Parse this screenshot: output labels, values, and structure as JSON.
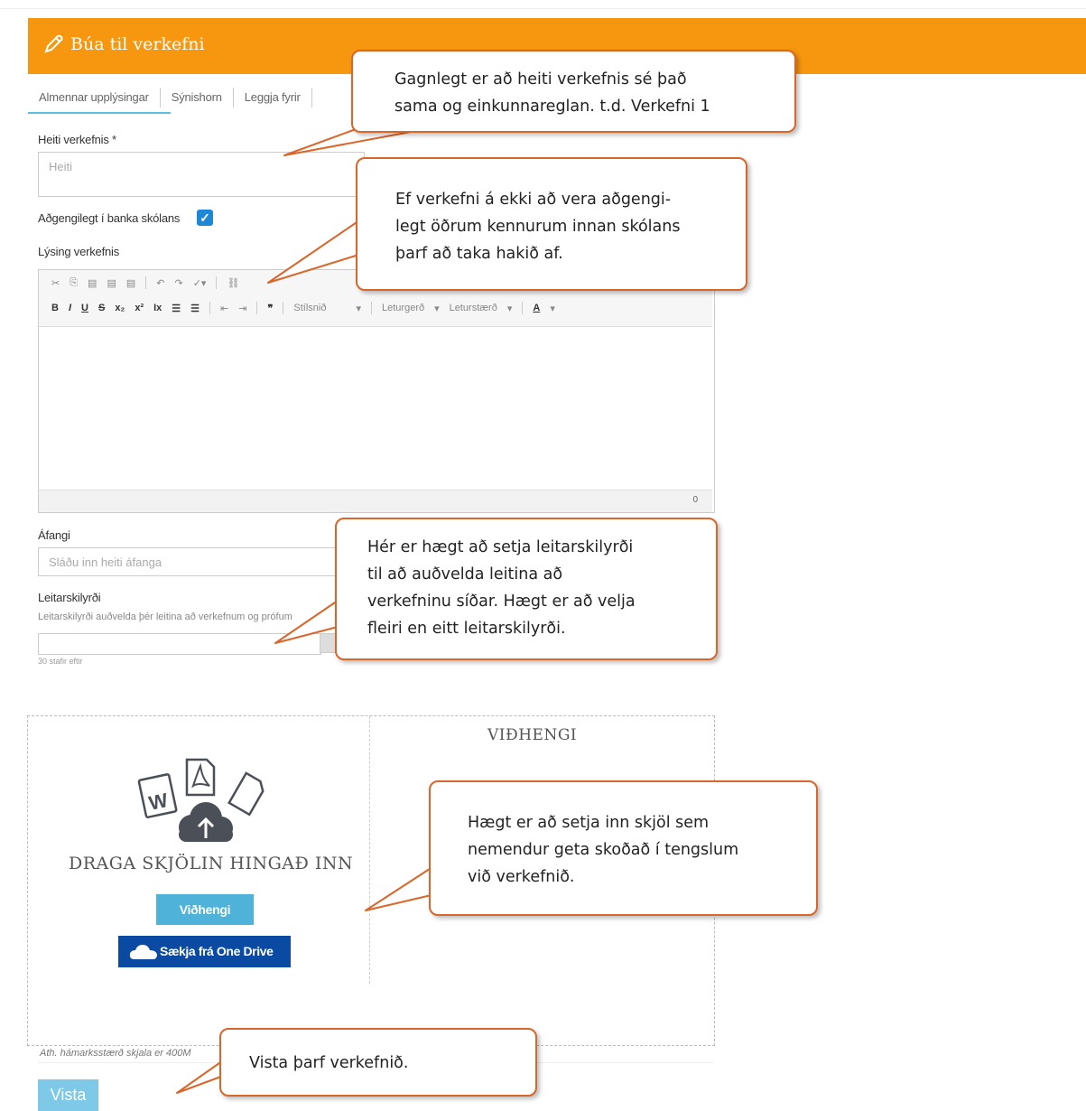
{
  "header": {
    "title": "Búa til verkefni"
  },
  "tabs": [
    {
      "label": "Almennar upplýsingar"
    },
    {
      "label": "Sýnishorn"
    },
    {
      "label": "Leggja fyrir"
    }
  ],
  "form": {
    "name_label": "Heiti verkefnis *",
    "name_placeholder": "Heiti",
    "bank_label": "Aðgengilegt í banka skólans",
    "bank_checked": true,
    "description_label": "Lýsing verkefnis",
    "editor": {
      "format_label": "Stílsnið",
      "font_label": "Leturgerð",
      "size_label": "Leturstærð",
      "char_count": "0"
    },
    "course_label": "Áfangi",
    "course_placeholder": "Sláðu inn heiti áfanga",
    "search_label": "Leitarskilyrði",
    "search_help": "Leitarskilyrði auðvelda þér leitina að verkefnum og prófum",
    "chars_left": "30 stafir eftir"
  },
  "attachments": {
    "drop_text": "DRAGA SKJÖLIN HINGAÐ INN",
    "attach_button": "Viðhengi",
    "onedrive_button": "Sækja frá One Drive",
    "heading": "VIÐHENGI",
    "note": "Ath. hámarksstærð skjala er 400M"
  },
  "save_button": "Vista",
  "callouts": {
    "c1_line1": "Gagnlegt er að heiti verkefnis sé það",
    "c1_line2": "sama og einkunnareglan. t.d. Verkefni 1",
    "c2_line1": "Ef verkefni á ekki að vera aðgengi-",
    "c2_line2": "legt öðrum kennurum innan skólans",
    "c2_line3": "þarf að taka hakið af.",
    "c3_line1": "Hér er hægt að setja leitarskilyrði",
    "c3_line2": "til að auðvelda leitina að",
    "c3_line3": "verkefninu síðar. Hægt er að velja",
    "c3_line4": "fleiri en eitt leitarskilyrði.",
    "c4_line1": "Hægt er að setja inn skjöl sem",
    "c4_line2": "nemendur geta skoðað í tengslum",
    "c4_line3": "við verkefnið.",
    "c5_line1": "Vista þarf verkefnið."
  }
}
